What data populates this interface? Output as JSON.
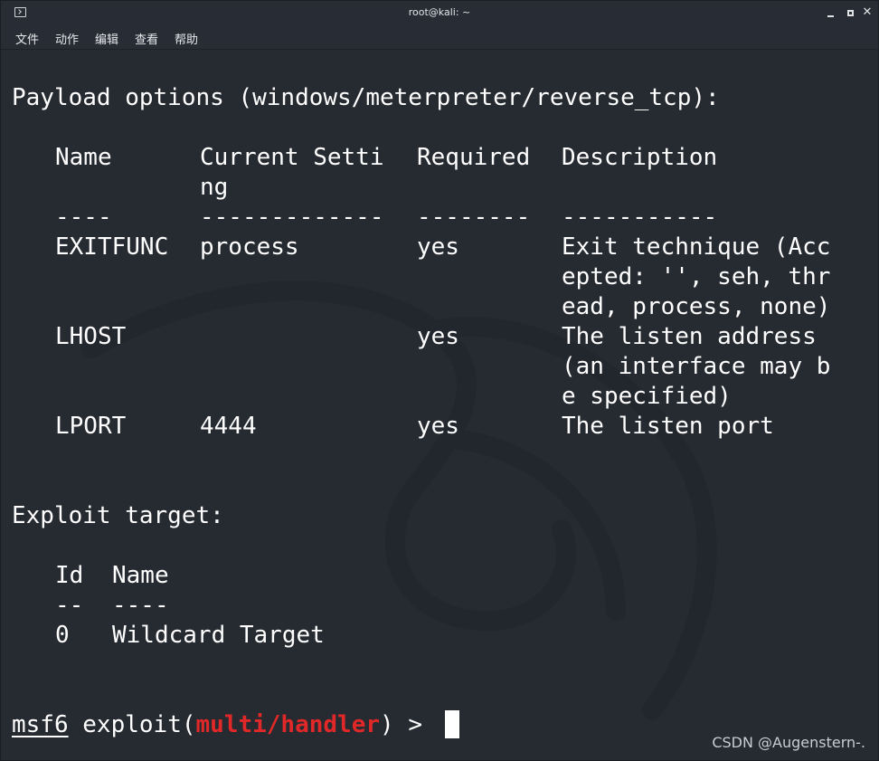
{
  "window": {
    "title": "root@kali: ~",
    "menu": [
      "文件",
      "动作",
      "编辑",
      "查看",
      "帮助"
    ],
    "controls": {
      "minimize": "",
      "maximize": "",
      "close": "✕"
    }
  },
  "terminal": {
    "payload_header": "Payload options (windows/meterpreter/reverse_tcp):",
    "payload_table": {
      "columns": [
        "Name",
        "Current Setting",
        "Required",
        "Description"
      ],
      "col_header_wrap": {
        "current_setting_line1": "Current Setti",
        "current_setting_line2": "ng"
      },
      "separators": [
        "----",
        "-------------",
        "--------",
        "-----------"
      ],
      "rows": [
        {
          "name": "EXITFUNC",
          "setting": "process",
          "required": "yes",
          "description_lines": [
            "Exit technique (Acc",
            "epted: '', seh, thr",
            "ead, process, none)"
          ]
        },
        {
          "name": "LHOST",
          "setting": "",
          "required": "yes",
          "description_lines": [
            "The listen address",
            "(an interface may b",
            "e specified)"
          ]
        },
        {
          "name": "LPORT",
          "setting": "4444",
          "required": "yes",
          "description_lines": [
            "The listen port"
          ]
        }
      ]
    },
    "exploit_header": "Exploit target:",
    "exploit_table": {
      "columns": [
        "Id",
        "Name"
      ],
      "separators": [
        "--",
        "----"
      ],
      "rows": [
        {
          "id": "0",
          "name": "Wildcard Target"
        }
      ]
    },
    "prompt": {
      "prefix": "msf6",
      "mid": " exploit(",
      "module": "multi/handler",
      "suffix": ") > "
    }
  },
  "watermark": "CSDN @Augenstern-."
}
